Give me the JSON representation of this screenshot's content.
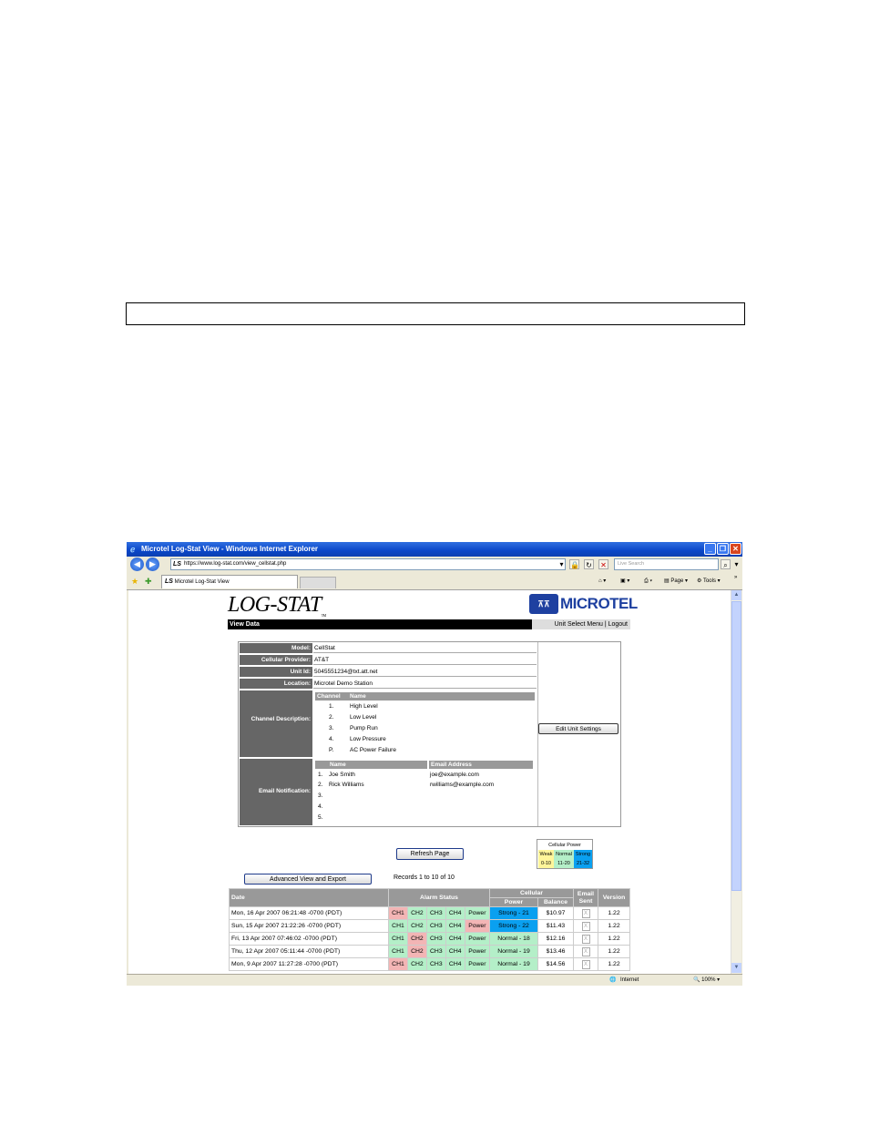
{
  "window": {
    "title": "Microtel Log-Stat View - Windows Internet Explorer",
    "url": "https://www.log-stat.com/view_cellstat.php",
    "search_placeholder": "Live Search",
    "tab_label": "Microtel Log-Stat View",
    "cmd_page": "Page",
    "cmd_tools": "Tools",
    "status_zone": "Internet",
    "zoom": "100%"
  },
  "header": {
    "logo_text": "LOG-STAT",
    "logo_tm": "TM",
    "brand": "MICROTEL",
    "section_title": "View Data",
    "menu": "Unit Select Menu | Logout"
  },
  "unit": {
    "model_label": "Model:",
    "model": "CellStat",
    "provider_label": "Cellular Provider:",
    "provider": "AT&T",
    "unitid_label": "Unit Id:",
    "unitid": "5045551234@txt.att.net",
    "location_label": "Location:",
    "location": "Microtel Demo Station",
    "channel_label": "Channel Description:",
    "channel_headers": [
      "Channel",
      "Name"
    ],
    "channels": [
      {
        "num": "1.",
        "name": "High Level"
      },
      {
        "num": "2.",
        "name": "Low Level"
      },
      {
        "num": "3.",
        "name": "Pump Run"
      },
      {
        "num": "4.",
        "name": "Low Pressure"
      },
      {
        "num": "P.",
        "name": "AC Power Failure"
      }
    ],
    "email_label": "Email Notification:",
    "email_headers": [
      "Name",
      "Email Address"
    ],
    "emails": [
      {
        "num": "1.",
        "name": "Joe Smith",
        "email": "joe@example.com"
      },
      {
        "num": "2.",
        "name": "Rick Williams",
        "email": "rwilliams@example.com"
      },
      {
        "num": "3.",
        "name": "",
        "email": ""
      },
      {
        "num": "4.",
        "name": "",
        "email": ""
      },
      {
        "num": "5.",
        "name": "",
        "email": ""
      }
    ],
    "edit_button": "Edit Unit Settings"
  },
  "controls": {
    "refresh_button": "Refresh Page",
    "advanced_button": "Advanced View and Export",
    "records": "Records 1 to 10 of 10"
  },
  "legend": {
    "title": "Cellular Power",
    "labels": [
      "Weak",
      "Normal",
      "Strong"
    ],
    "ranges": [
      "0-10",
      "11-20",
      "21-32"
    ]
  },
  "table": {
    "headers": {
      "date": "Date",
      "alarm": "Alarm Status",
      "cellular": "Cellular",
      "power": "Power",
      "balance": "Balance",
      "email": "Email Sent",
      "version": "Version"
    },
    "rows": [
      {
        "date": "Mon, 16 Apr 2007 06:21:48 -0700 (PDT)",
        "alarms": [
          "bad",
          "ok",
          "ok",
          "ok",
          "ok"
        ],
        "power": "Strong - 21",
        "power_level": "strong",
        "balance": "$10.97",
        "version": "1.22"
      },
      {
        "date": "Sun, 15 Apr 2007 21:22:26 -0700 (PDT)",
        "alarms": [
          "ok",
          "ok",
          "ok",
          "ok",
          "bad"
        ],
        "power": "Strong - 22",
        "power_level": "strong",
        "balance": "$11.43",
        "version": "1.22"
      },
      {
        "date": "Fri, 13 Apr 2007 07:46:02 -0700 (PDT)",
        "alarms": [
          "ok",
          "bad",
          "ok",
          "ok",
          "ok"
        ],
        "power": "Normal - 18",
        "power_level": "normal",
        "balance": "$12.16",
        "version": "1.22"
      },
      {
        "date": "Thu, 12 Apr 2007 05:11:44 -0700 (PDT)",
        "alarms": [
          "ok",
          "bad",
          "ok",
          "ok",
          "ok"
        ],
        "power": "Normal - 19",
        "power_level": "normal",
        "balance": "$13.46",
        "version": "1.22"
      },
      {
        "date": "Mon, 9 Apr 2007 11:27:28 -0700 (PDT)",
        "alarms": [
          "bad",
          "ok",
          "ok",
          "ok",
          "ok"
        ],
        "power": "Normal - 19",
        "power_level": "normal",
        "balance": "$14.56",
        "version": "1.22"
      }
    ],
    "alarm_labels": [
      "CH1",
      "CH2",
      "CH3",
      "CH4",
      "Power"
    ],
    "email_mark": "X"
  },
  "colors": {
    "alarm_ok": "#b4efc8",
    "alarm_bad": "#f3b5b5",
    "power_strong": "#0aa0f0",
    "power_weak": "#fff59a"
  }
}
